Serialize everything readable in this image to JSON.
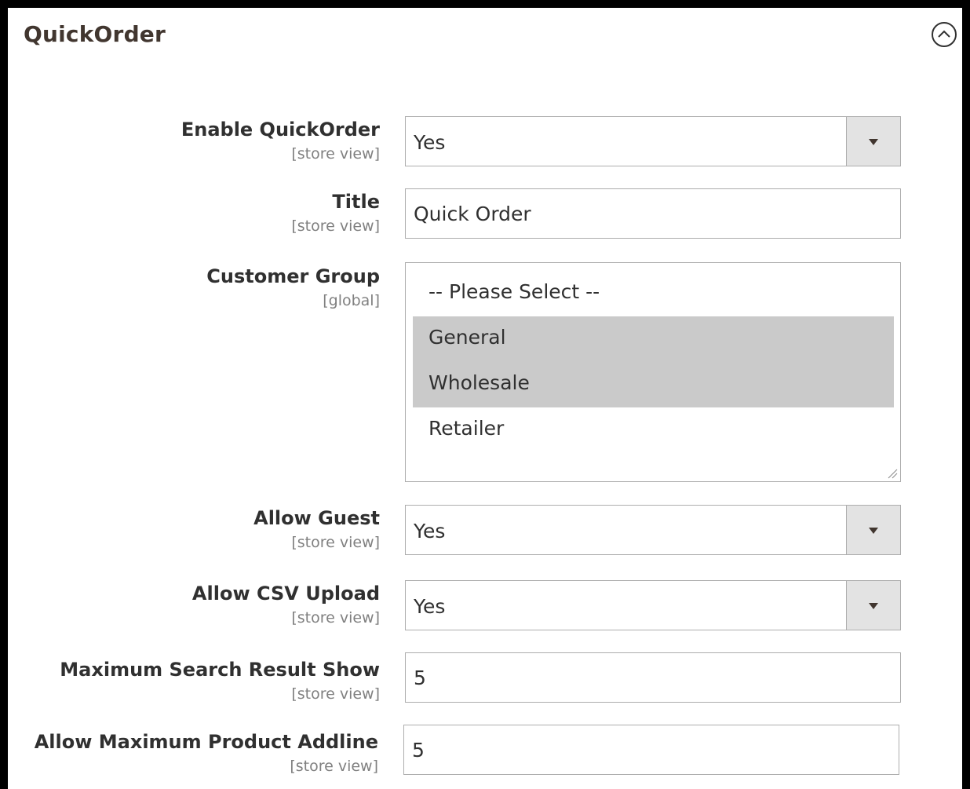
{
  "section": {
    "title": "QuickOrder"
  },
  "fields": {
    "enable_quickorder": {
      "label": "Enable QuickOrder",
      "scope": "[store view]",
      "value": "Yes"
    },
    "title": {
      "label": "Title",
      "scope": "[store view]",
      "value": "Quick Order"
    },
    "customer_group": {
      "label": "Customer Group",
      "scope": "[global]",
      "options": [
        {
          "label": "-- Please Select --",
          "selected": false
        },
        {
          "label": "General",
          "selected": true
        },
        {
          "label": "Wholesale",
          "selected": true
        },
        {
          "label": "Retailer",
          "selected": false
        }
      ]
    },
    "allow_guest": {
      "label": "Allow Guest",
      "scope": "[store view]",
      "value": "Yes"
    },
    "allow_csv_upload": {
      "label": "Allow CSV Upload",
      "scope": "[store view]",
      "value": "Yes"
    },
    "max_search_result": {
      "label": "Maximum Search Result Show",
      "scope": "[store view]",
      "value": "5"
    },
    "max_product_addline": {
      "label": "Allow Maximum Product Addline",
      "scope": "[store view]",
      "value": "5"
    }
  },
  "colors": {
    "selected_option_bg": "#cacaca",
    "dropdown_arrow_bg": "#e3e3e3",
    "field_border": "#adadad",
    "label_text": "#303030",
    "scope_text": "#808080"
  },
  "icons": {
    "collapse": "chevron-up-circle-icon",
    "dropdown": "caret-down-icon",
    "resize": "resize-grip-icon"
  }
}
